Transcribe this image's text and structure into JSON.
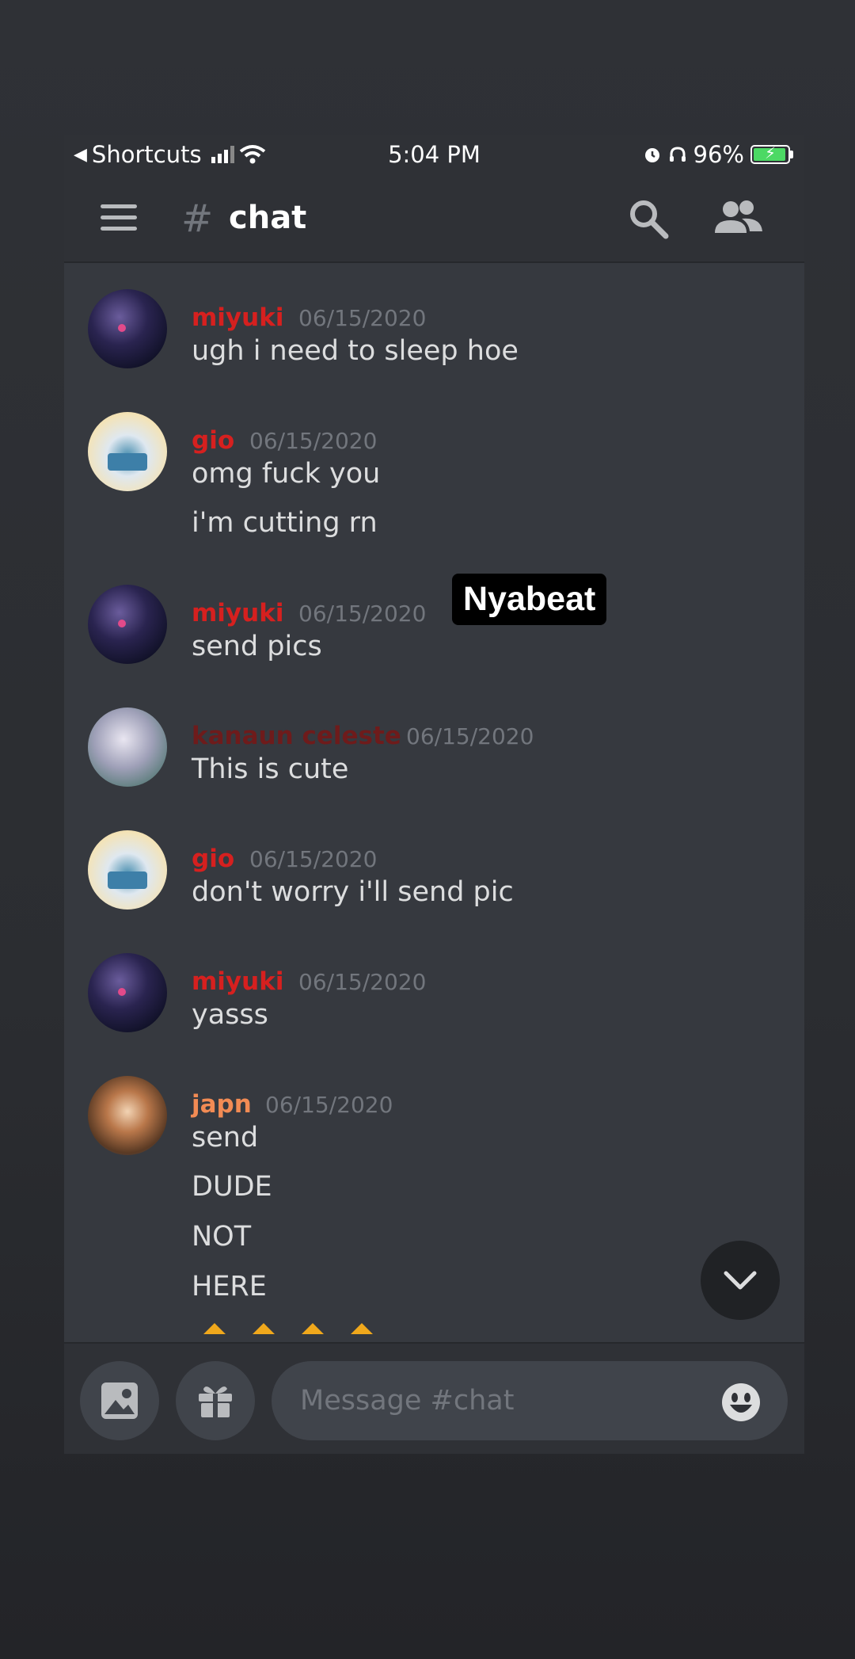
{
  "status_bar": {
    "back_app": "Shortcuts",
    "time": "5:04 PM",
    "battery": "96%"
  },
  "header": {
    "channel_prefix": "#",
    "channel_name": "chat"
  },
  "colors": {
    "name_red": "#d6201f",
    "name_orange": "#f28b54",
    "name_dark_red": "#6e1b1b",
    "background": "#36393f"
  },
  "messages": [
    {
      "author": "miyuki",
      "timestamp": "06/15/2020",
      "lines": [
        "ugh i need to sleep hoe"
      ]
    },
    {
      "author": "gio",
      "timestamp": "06/15/2020",
      "lines": [
        "omg fuck you",
        "i'm cutting rn"
      ]
    },
    {
      "author": "miyuki",
      "timestamp": "06/15/2020",
      "lines": [
        "send pics"
      ]
    },
    {
      "author": "kanaun celeste",
      "timestamp": "06/15/2020",
      "lines": [
        "This is cute"
      ]
    },
    {
      "author": "gio",
      "timestamp": "06/15/2020",
      "lines": [
        "don't worry i'll send pic"
      ]
    },
    {
      "author": "miyuki",
      "timestamp": "06/15/2020",
      "lines": [
        "yasss"
      ]
    },
    {
      "author": "japn",
      "timestamp": "06/15/2020",
      "lines": [
        "send",
        "DUDE",
        "NOT",
        "HERE"
      ]
    }
  ],
  "watermark": "Nyabeat",
  "composer": {
    "placeholder": "Message #chat"
  }
}
